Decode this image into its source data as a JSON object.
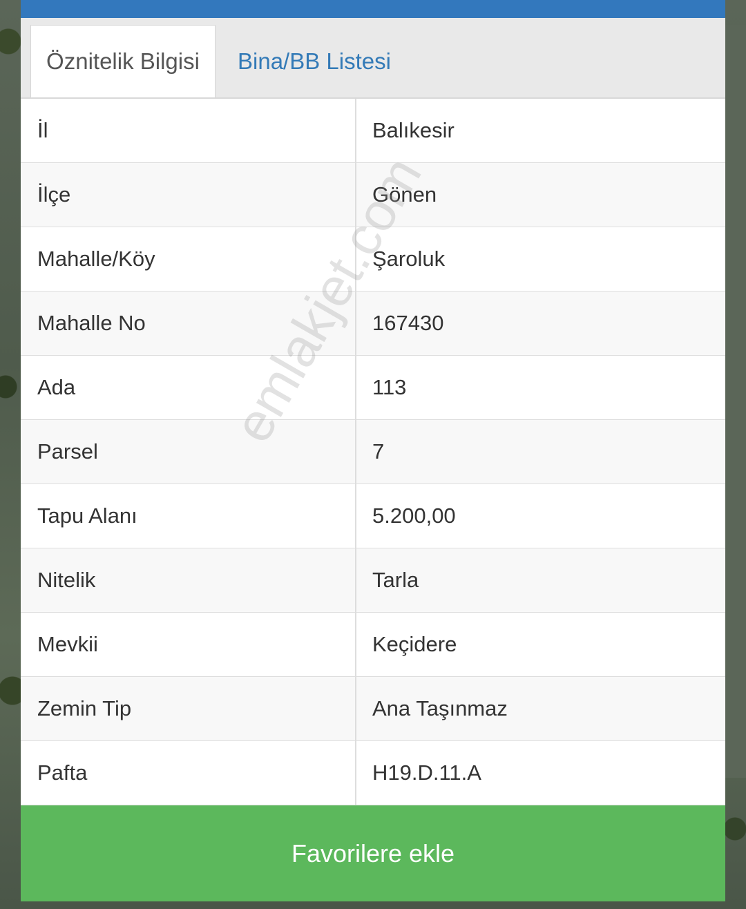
{
  "tabs": [
    {
      "label": "Öznitelik Bilgisi",
      "active": true
    },
    {
      "label": "Bina/BB Listesi",
      "active": false
    }
  ],
  "rows": [
    {
      "label": "İl",
      "value": "Balıkesir"
    },
    {
      "label": "İlçe",
      "value": "Gönen"
    },
    {
      "label": "Mahalle/Köy",
      "value": "Şaroluk"
    },
    {
      "label": "Mahalle No",
      "value": "167430"
    },
    {
      "label": "Ada",
      "value": "113"
    },
    {
      "label": "Parsel",
      "value": "7"
    },
    {
      "label": "Tapu Alanı",
      "value": "5.200,00"
    },
    {
      "label": "Nitelik",
      "value": "Tarla"
    },
    {
      "label": "Mevkii",
      "value": "Keçidere"
    },
    {
      "label": "Zemin Tip",
      "value": "Ana Taşınmaz"
    },
    {
      "label": "Pafta",
      "value": "H19.D.11.A"
    }
  ],
  "favorite_button": {
    "label": "Favorilere ekle"
  },
  "watermark": "emlakjet.com",
  "colors": {
    "topbar": "#3378bd",
    "link": "#337ab7",
    "button": "#5cb85c"
  }
}
